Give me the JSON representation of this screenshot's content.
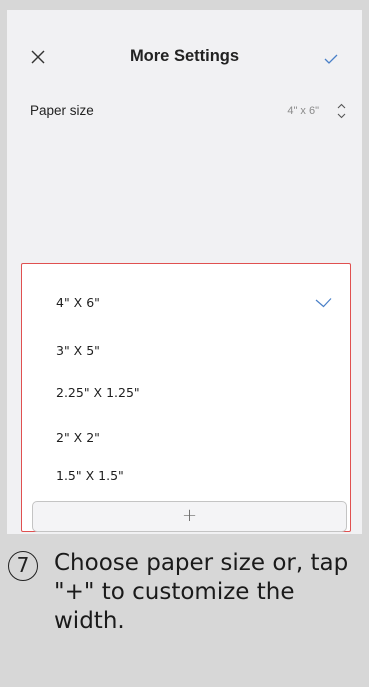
{
  "header": {
    "title": "More Settings",
    "close_icon": "close-icon",
    "confirm_icon": "checkmark-icon"
  },
  "paper_setting": {
    "label": "Paper size",
    "value": "4\" x 6\"",
    "stepper_icon": "up-down-chevron-icon"
  },
  "paper_options": [
    {
      "label": "4\" X 6\"",
      "selected": true
    },
    {
      "label": "3\" X 5\"",
      "selected": false
    },
    {
      "label": "2.25\" X 1.25\"",
      "selected": false
    },
    {
      "label": "2\" X 2\"",
      "selected": false
    },
    {
      "label": "1.5\" X 1.5\"",
      "selected": false
    }
  ],
  "add_button": {
    "label": "+"
  },
  "instruction": {
    "step": "7",
    "text": "Choose paper size or, tap \"+\" to customize the width."
  },
  "colors": {
    "accent": "#4a80c8",
    "highlight_border": "#e05050",
    "background": "#d7d7d7",
    "screen": "#f1f1f3"
  }
}
